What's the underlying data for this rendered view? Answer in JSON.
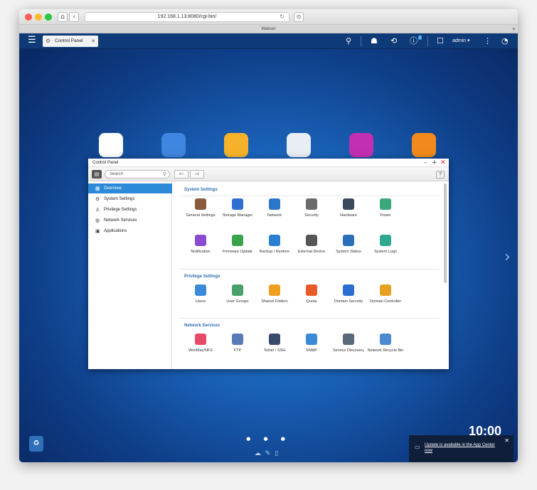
{
  "browser": {
    "url": "192.168.1.13:8080/cgi-bin/",
    "tab_title": "Watson",
    "reload_glyph": "↻",
    "newtab_glyph": "+"
  },
  "taskbar": {
    "open_app_tab": "Control Panel",
    "user": "admin ▾",
    "notification_count": "2"
  },
  "window": {
    "title": "Control Panel",
    "search_placeholder": "Search",
    "help_label": "?"
  },
  "sidebar": {
    "items": [
      {
        "label": "Overview",
        "icon": "grid-icon",
        "active": true
      },
      {
        "label": "System Settings",
        "icon": "gear-icon"
      },
      {
        "label": "Privilege Settings",
        "icon": "user-icon"
      },
      {
        "label": "Network Services",
        "icon": "globe-icon"
      },
      {
        "label": "Applications",
        "icon": "lock-icon"
      }
    ]
  },
  "sections": {
    "system": {
      "title": "System Settings",
      "apps": [
        {
          "label": "General Settings",
          "color": "#8a5a3c"
        },
        {
          "label": "Storage Manager",
          "color": "#2f6fd0"
        },
        {
          "label": "Network",
          "color": "#2a77c9"
        },
        {
          "label": "Security",
          "color": "#6b6b6b"
        },
        {
          "label": "Hardware",
          "color": "#3a4a5a"
        },
        {
          "label": "Power",
          "color": "#3aa87a"
        },
        {
          "label": "Notification",
          "color": "#8a4bd0"
        },
        {
          "label": "Firmware Update",
          "color": "#3aa34a"
        },
        {
          "label": "Backup / Restore",
          "color": "#2a7fd0"
        },
        {
          "label": "External Device",
          "color": "#555555"
        },
        {
          "label": "System Status",
          "color": "#2a6fb8"
        },
        {
          "label": "System Logs",
          "color": "#2fa890"
        }
      ]
    },
    "privilege": {
      "title": "Privilege Settings",
      "apps": [
        {
          "label": "Users",
          "color": "#3a8ad8"
        },
        {
          "label": "User Groups",
          "color": "#4aa06a"
        },
        {
          "label": "Shared Folders",
          "color": "#f0a020"
        },
        {
          "label": "Quota",
          "color": "#e85a2a"
        },
        {
          "label": "Domain Security",
          "color": "#2a6fd0"
        },
        {
          "label": "Domain Controller",
          "color": "#e8a020"
        }
      ]
    },
    "network": {
      "title": "Network Services",
      "apps": [
        {
          "label": "Win/Mac/NFS",
          "color": "#e84a6a"
        },
        {
          "label": "FTP",
          "color": "#5a7ab8"
        },
        {
          "label": "Telnet / SSH",
          "color": "#3a4a6a"
        },
        {
          "label": "SNMP",
          "color": "#3a8ad8"
        },
        {
          "label": "Service Discovery",
          "color": "#5a6a7a"
        },
        {
          "label": "Network Recycle Bin",
          "color": "#4a8ad0"
        }
      ]
    }
  },
  "desktop": {
    "icons": [
      {
        "name": "control-panel-desktop-icon",
        "color": "#ffffff"
      },
      {
        "name": "storage-manager-desktop-icon",
        "color": "#3f86e0"
      },
      {
        "name": "file-station-desktop-icon",
        "color": "#f4b32a"
      },
      {
        "name": "users-desktop-icon",
        "color": "#e8eef4"
      },
      {
        "name": "hd-station-desktop-icon",
        "color": "#c22fb2"
      },
      {
        "name": "folder-desktop-icon",
        "color": "#f08a1c"
      }
    ],
    "clock": "10:00",
    "pager": "● ● ●"
  },
  "toast": {
    "text": "Update is available in the App Center now"
  }
}
